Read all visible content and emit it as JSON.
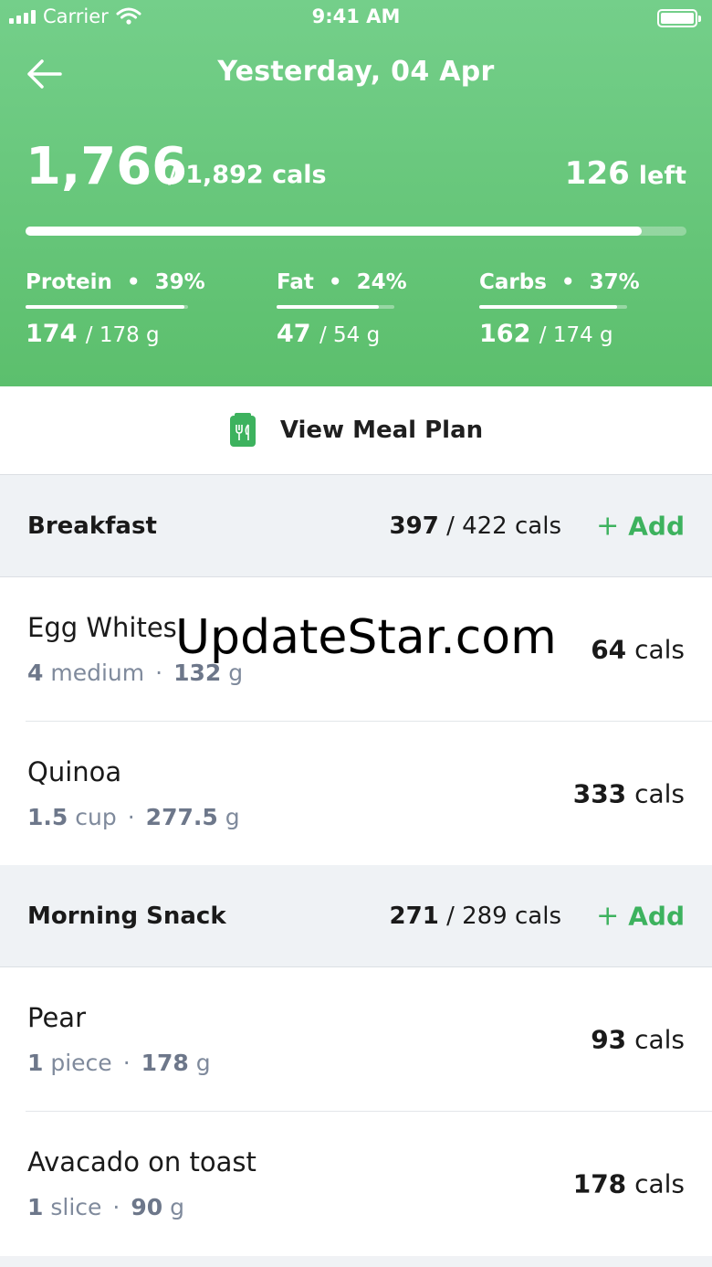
{
  "status_bar": {
    "carrier": "Carrier",
    "time": "9:41 AM"
  },
  "nav": {
    "title": "Yesterday, 04 Apr"
  },
  "summary": {
    "consumed": "1,766",
    "goal": "/  1,892 cals",
    "left_value": "126",
    "left_label": "left",
    "progress_fraction": 0.933
  },
  "macros": [
    {
      "name": "Protein",
      "percent": "39%",
      "amount": "174",
      "of": "/ 178 g",
      "progress_fraction": 0.98
    },
    {
      "name": "Fat",
      "percent": "24%",
      "amount": "47",
      "of": "/ 54 g",
      "progress_fraction": 0.87
    },
    {
      "name": "Carbs",
      "percent": "37%",
      "amount": "162",
      "of": "/ 174 g",
      "progress_fraction": 0.93
    }
  ],
  "meal_plan": {
    "label": "View Meal Plan",
    "icon": "meal-plan-icon"
  },
  "sections": [
    {
      "name": "Breakfast",
      "consumed": "397",
      "of": "/ 422 cals",
      "add_label": "Add",
      "items": [
        {
          "name": "Egg Whites",
          "qty": "4",
          "unit": "medium",
          "weight": "132",
          "weight_unit": "g",
          "cals": "64",
          "cals_unit": "cals"
        },
        {
          "name": "Quinoa",
          "qty": "1.5",
          "unit": "cup",
          "weight": "277.5",
          "weight_unit": "g",
          "cals": "333",
          "cals_unit": "cals"
        }
      ]
    },
    {
      "name": "Morning Snack",
      "consumed": "271",
      "of": "/ 289 cals",
      "add_label": "Add",
      "items": [
        {
          "name": "Pear",
          "qty": "1",
          "unit": "piece",
          "weight": "178",
          "weight_unit": "g",
          "cals": "93",
          "cals_unit": "cals"
        },
        {
          "name": "Avacado on toast",
          "qty": "1",
          "unit": "slice",
          "weight": "90",
          "weight_unit": "g",
          "cals": "178",
          "cals_unit": "cals"
        }
      ]
    }
  ],
  "watermark": "UpdateStar.com",
  "colors": {
    "header_green": "#5cbf6d",
    "accent_green": "#3db25e",
    "muted_text": "#7f8a9c"
  }
}
